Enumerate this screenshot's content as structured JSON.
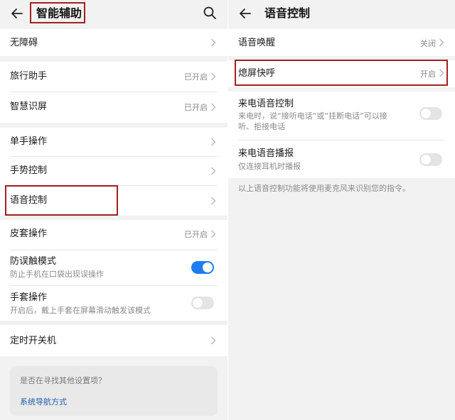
{
  "left": {
    "title": "智能辅助",
    "groups": [
      [
        {
          "label": "无障碍"
        }
      ],
      [
        {
          "label": "旅行助手",
          "value": "已开启"
        },
        {
          "label": "智慧识屏",
          "value": "已开启"
        }
      ],
      [
        {
          "label": "单手操作"
        },
        {
          "label": "手势控制"
        },
        {
          "label": "语音控制"
        }
      ],
      [
        {
          "label": "皮套操作",
          "value": "已开启"
        },
        {
          "label": "防误触模式",
          "sub": "防止手机在口袋出现误操作",
          "toggle": true
        },
        {
          "label": "手套操作",
          "sub": "开启后，戴上手套在屏幕滑动触发该模式",
          "toggle": false
        }
      ],
      [
        {
          "label": "定时开关机"
        }
      ]
    ],
    "hint": {
      "question": "是否在寻找其他设置项？",
      "link": "系统导航方式"
    }
  },
  "right": {
    "title": "语音控制",
    "groups": [
      [
        {
          "label": "语音唤醒",
          "value": "关闭"
        }
      ],
      [
        {
          "label": "熄屏快呼",
          "value": "开启"
        }
      ],
      [
        {
          "label": "来电语音控制",
          "sub": "来电时，说“接听电话”或“挂断电话”可以接",
          "sub2": "听、拒接电话",
          "toggle": false
        },
        {
          "label": "来电语音播报",
          "sub": "仅连接耳机时播报",
          "toggle": false
        }
      ]
    ],
    "note": "以上语音控制功能将使用麦克风来识别您的指令。"
  },
  "colors": {
    "accent": "#1f7cf0",
    "highlight": "#a32020",
    "link": "#1f5fb0"
  },
  "icons": {
    "back": "back-arrow-icon",
    "search": "search-icon",
    "chevron": "chevron-right-icon"
  }
}
